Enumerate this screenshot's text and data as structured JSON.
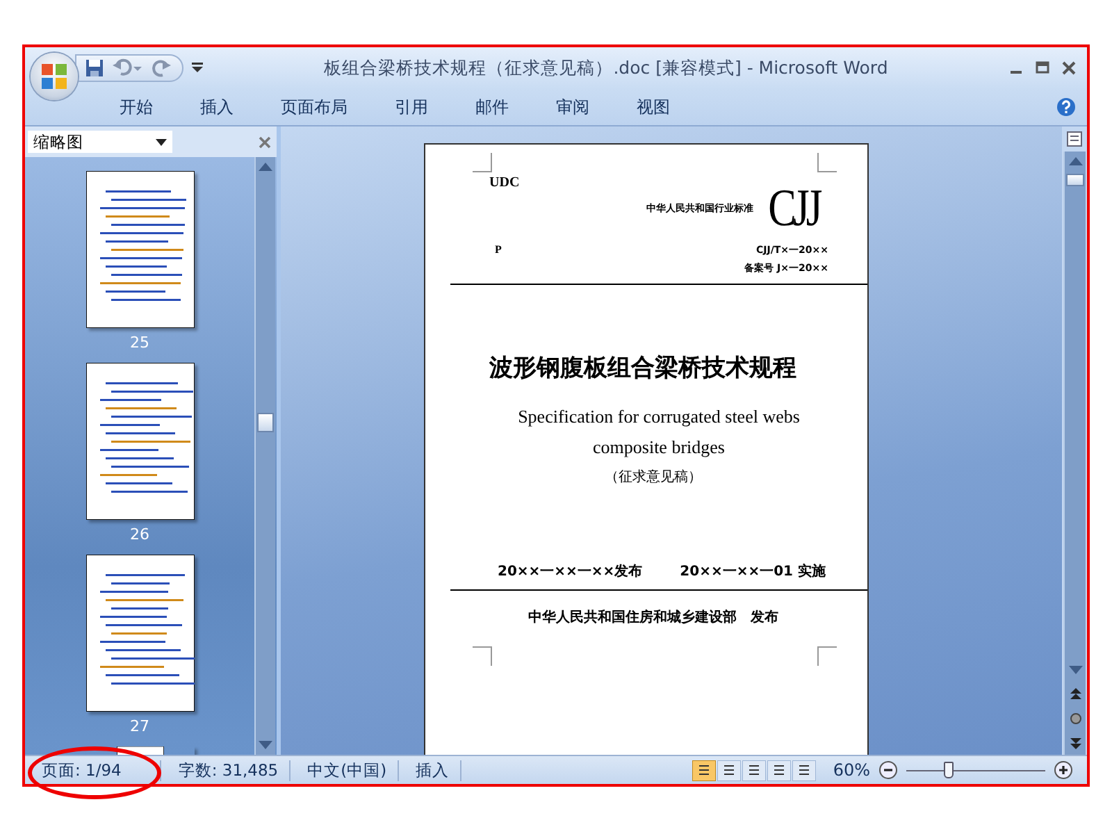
{
  "window": {
    "title": "板组合梁桥技术规程（征求意见稿）.doc [兼容模式] - Microsoft Word"
  },
  "tabs": [
    {
      "label": "开始"
    },
    {
      "label": "插入"
    },
    {
      "label": "页面布局"
    },
    {
      "label": "引用"
    },
    {
      "label": "邮件"
    },
    {
      "label": "审阅"
    },
    {
      "label": "视图"
    }
  ],
  "thumbnail_pane": {
    "title": "缩略图",
    "pages": [
      {
        "number": "25"
      },
      {
        "number": "26"
      },
      {
        "number": "27"
      }
    ]
  },
  "document": {
    "udc": "UDC",
    "standard_label": "中华人民共和国行业标准",
    "logo": "CJJ",
    "p": "P",
    "code": "CJJ/T×一20××",
    "record_no": "备案号 J×一20××",
    "title": "波形钢腹板组合梁桥技术规程",
    "subtitle_en": [
      "Specification for corrugated steel webs",
      "composite bridges"
    ],
    "draft": "（征求意见稿）",
    "publish_date": "20××一××一××发布",
    "effective_date": "20××一××一01 实施",
    "publisher": "中华人民共和国住房和城乡建设部　发布"
  },
  "status_bar": {
    "items": [
      "页面: 1/94",
      "字数: 31,485",
      "中文(中国)",
      "插入"
    ],
    "views": [
      {
        "selected": true
      },
      {
        "selected": false
      },
      {
        "selected": false
      },
      {
        "selected": false
      },
      {
        "selected": false
      }
    ],
    "zoom": "60%",
    "zoom_level": {
      "level": 0.3
    }
  }
}
